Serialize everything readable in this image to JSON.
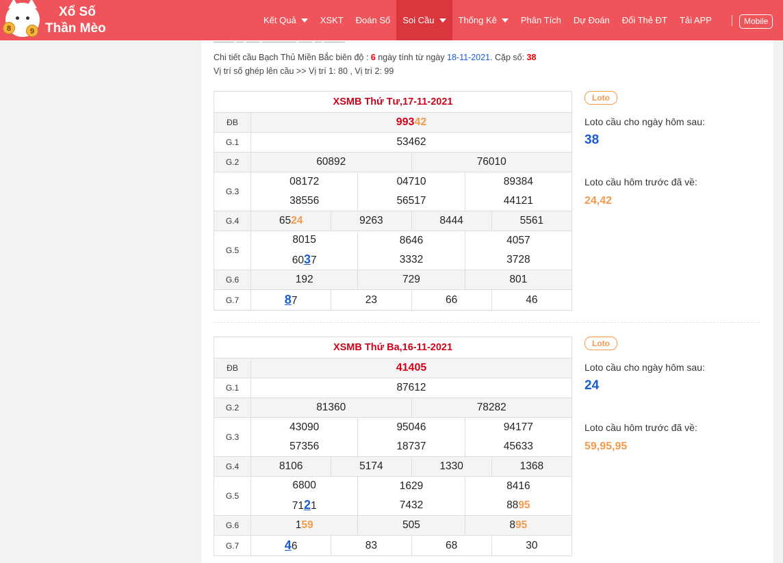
{
  "brand": {
    "line1": "Xổ Số",
    "line2": "Thần Mèo",
    "ball1": "8",
    "ball2": "9"
  },
  "nav": {
    "items": [
      "Kết Quả",
      "XSKT",
      "Đoán Số",
      "Soi Cầu",
      "Thống Kê",
      "Phân Tích",
      "Dự Đoán",
      "Đổi Thẻ ĐT",
      "Tải APP"
    ],
    "mobile": "Mobile"
  },
  "info": {
    "p1": "Chi tiết cầu Bạch Thủ Miền Bắc biên độ : ",
    "bien_do": "6",
    "p2": " ngày tính từ ngày ",
    "date": "18-11-2021",
    "p3": ". Cặp số: ",
    "cap_so": "38",
    "line2": "Vị trí số ghép lên cầu >> Vị trí 1: 80 , Vị trí 2: 99"
  },
  "labels": {
    "db": "ĐB",
    "g1": "G.1",
    "g2": "G.2",
    "g3": "G.3",
    "g4": "G.4",
    "g5": "G.5",
    "g6": "G.6",
    "g7": "G.7"
  },
  "side_text": {
    "badge": "Loto",
    "next": "Loto cầu cho ngày hôm sau:",
    "prev": "Loto cầu hôm trước đã về:"
  },
  "results": [
    {
      "title": "XSMB Thứ Tư,17-11-2021",
      "db": [
        "993",
        "42"
      ],
      "g1": "53462",
      "g2": [
        "60892",
        "76010"
      ],
      "g3": [
        "08172",
        "04710",
        "89384",
        "38556",
        "56517",
        "44121"
      ],
      "g4": [
        [
          "65",
          "24"
        ],
        "9263",
        "8444",
        "5561"
      ],
      "g5": [
        "8015",
        "8646",
        "4057",
        [
          "60",
          "3",
          "7"
        ],
        "3332",
        "3728"
      ],
      "g6": [
        "192",
        "729",
        "801"
      ],
      "g7": [
        [
          "8",
          "7"
        ],
        "23",
        "66",
        "46"
      ],
      "next": "38",
      "prev": "24,42"
    },
    {
      "title": "XSMB Thứ Ba,16-11-2021",
      "db": "41405",
      "g1": "87612",
      "g2": [
        "81360",
        "78282"
      ],
      "g3": [
        "43090",
        "95046",
        "94177",
        "57356",
        "18737",
        "45633"
      ],
      "g4": [
        "8106",
        "5174",
        "1330",
        "1368"
      ],
      "g5": [
        "6800",
        "1629",
        "8416",
        [
          "71",
          "2",
          "1"
        ],
        "7432",
        [
          "88",
          "95"
        ]
      ],
      "g6": [
        [
          "1",
          "59"
        ],
        "505",
        [
          "8",
          "95"
        ]
      ],
      "g7": [
        [
          "4",
          "6"
        ],
        "83",
        "68",
        "30"
      ],
      "next": "24",
      "prev": "59,95,95"
    }
  ]
}
